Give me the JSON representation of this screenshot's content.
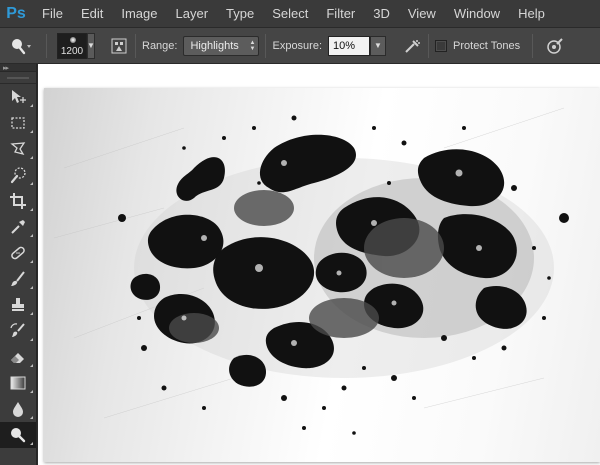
{
  "app": {
    "logo": "Ps"
  },
  "menu": [
    "File",
    "Edit",
    "Image",
    "Layer",
    "Type",
    "Select",
    "Filter",
    "3D",
    "View",
    "Window",
    "Help"
  ],
  "options": {
    "brush_size": "1200",
    "range_label": "Range:",
    "range_value": "Highlights",
    "exposure_label": "Exposure:",
    "exposure_value": "10%",
    "protect_tones_label": "Protect Tones",
    "protect_tones_checked": false
  },
  "toolbar": {
    "tools": [
      "move-tool",
      "marquee-tool",
      "lasso-tool",
      "quick-selection-tool",
      "crop-tool",
      "eyedropper-tool",
      "healing-brush-tool",
      "brush-tool",
      "clone-stamp-tool",
      "history-brush-tool",
      "eraser-tool",
      "gradient-tool",
      "blur-tool",
      "dodge-tool"
    ],
    "active_tool": "dodge-tool"
  },
  "colors": {
    "accent": "#2f9ad8",
    "menubar": "#3a3a3a",
    "optionsbar": "#454545",
    "toolbar": "#3c3c3c"
  }
}
